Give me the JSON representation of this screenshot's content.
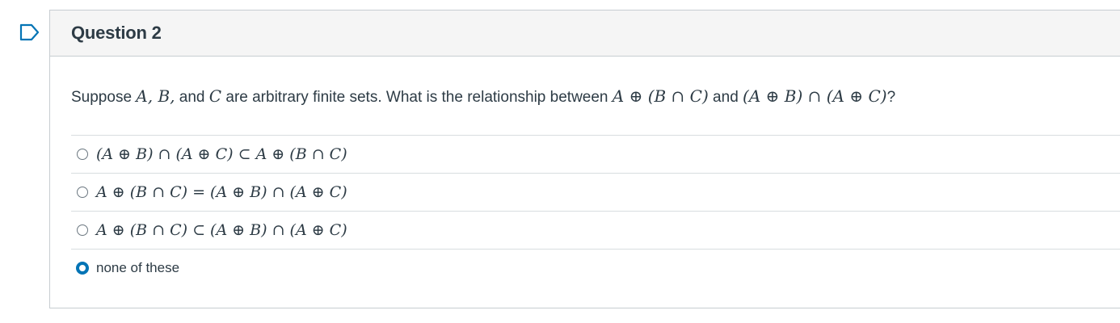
{
  "question": {
    "title": "Question 2",
    "text_prefix": "Suppose ",
    "set_list": "A, B,",
    "text_and": " and ",
    "set_c": "C",
    "text_middle": " are arbitrary finite sets. What is the relationship between ",
    "expr_1": "A ⊕ (B ∩ C)",
    "text_and2": " and ",
    "expr_2": "(A ⊕ B) ∩ (A ⊕ C)",
    "text_suffix": "?"
  },
  "answers": [
    {
      "label": "(A ⊕ B) ∩ (A ⊕ C) ⊂ A ⊕ (B ∩ C)",
      "selected": false
    },
    {
      "label": "A ⊕ (B ∩ C) = (A ⊕ B) ∩ (A ⊕ C)",
      "selected": false
    },
    {
      "label": "A ⊕ (B ∩ C) ⊂ (A ⊕ B) ∩ (A ⊕ C)",
      "selected": false
    },
    {
      "label": "none of these",
      "selected": true
    }
  ],
  "colors": {
    "accent": "#0374b5",
    "text": "#2d3b45",
    "header_bg": "#f5f5f5",
    "border": "#c7cdd1"
  },
  "icons": {
    "flag": "flag-icon"
  }
}
